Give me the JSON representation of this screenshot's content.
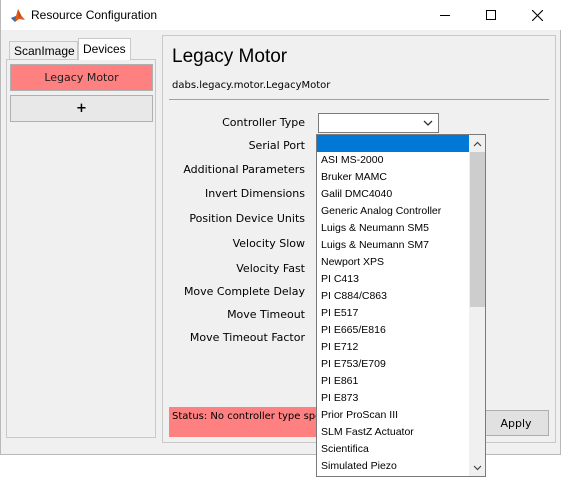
{
  "window": {
    "title": "Resource Configuration"
  },
  "tabs": [
    {
      "label": "ScanImage",
      "selected": false
    },
    {
      "label": "Devices",
      "selected": true
    }
  ],
  "devices": {
    "items": [
      {
        "label": "Legacy Motor",
        "selected": true
      }
    ],
    "add_label": "+"
  },
  "config": {
    "title": "Legacy Motor",
    "class_path": "dabs.legacy.motor.LegacyMotor",
    "fields": [
      "Controller Type",
      "Serial Port",
      "Additional Parameters",
      "Invert Dimensions",
      "Position Device Units",
      "Velocity Slow",
      "Velocity Fast",
      "Move Complete Delay",
      "Move Timeout",
      "Move Timeout Factor"
    ],
    "controller_type_value": "",
    "status": "Status: No controller type specified",
    "apply_label": "Apply"
  },
  "dropdown": {
    "options": [
      "",
      "ASI MS-2000",
      "Bruker MAMC",
      "Galil DMC4040",
      "Generic Analog Controller",
      "Luigs & Neumann SM5",
      "Luigs & Neumann SM7",
      "Newport XPS",
      "PI C413",
      "PI C884/C863",
      "PI E517",
      "PI E665/E816",
      "PI E712",
      "PI E753/E709",
      "PI E861",
      "PI E873",
      "Prior ProScan III",
      "SLM FastZ Actuator",
      "Scientifica",
      "Simulated Piezo"
    ],
    "selected_index": 0
  },
  "colors": {
    "accent_error": "#ff8080",
    "selection": "#0078d7"
  }
}
